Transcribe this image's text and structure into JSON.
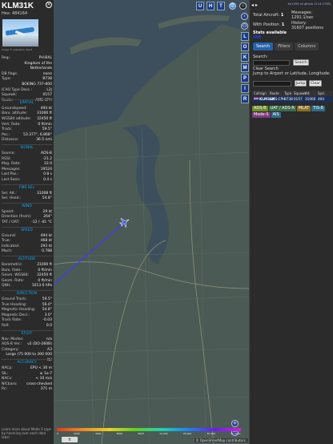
{
  "infoblock": {
    "callsign": "KLM31K",
    "hex": "Hex: 484164",
    "photo_credit": "Image © sebastian david",
    "pre_rows": [
      {
        "k": "Reg.:",
        "v": "PH-BXL"
      },
      {
        "k": "",
        "v": "Kingdom of the Netherlands"
      },
      {
        "k": "DB flags:",
        "v": "none"
      },
      {
        "k": "Type:",
        "v": "B738"
      },
      {
        "k": "",
        "v": "BOEING 737-800"
      },
      {
        "k": "ICAO Type Desc.:",
        "v": "L2J"
      },
      {
        "k": "Squawk:",
        "v": "0157"
      },
      {
        "k": "Route:",
        "v": "AMS-CPH"
      }
    ],
    "sections": [
      {
        "title": "SPATIAL",
        "rows": [
          {
            "k": "Groundspeed:",
            "v": "494 kt"
          },
          {
            "k": "Baro. altitude:",
            "v": "31000 ft"
          },
          {
            "k": "WGS84 altitude:",
            "v": "32450 ft"
          },
          {
            "k": "Vert. Rate:",
            "v": "0 ft/min"
          },
          {
            "k": "Track:",
            "v": "59.5°"
          },
          {
            "k": "Pos.:",
            "v": "53.377°, 6.868°"
          },
          {
            "k": "Distance:",
            "v": "36.5 nmi"
          }
        ]
      },
      {
        "title": "SIGNAL",
        "rows": [
          {
            "k": "Source:",
            "v": "ADS-B"
          },
          {
            "k": "RSSI:",
            "v": "-21.2"
          },
          {
            "k": "Msg. Rate:",
            "v": "22.0"
          },
          {
            "k": "Messages:",
            "v": "19524"
          },
          {
            "k": "Last Pos.:",
            "v": "0.8 s"
          },
          {
            "k": "Last Seen:",
            "v": "0.4 s"
          }
        ]
      },
      {
        "title": "FMS SEL",
        "rows": [
          {
            "k": "Sel. Alt.:",
            "v": "31008 ft"
          },
          {
            "k": "Sel. Head.:",
            "v": "54.8°"
          }
        ]
      },
      {
        "title": "WIND",
        "rows": [
          {
            "k": "Speed:",
            "v": "29 kt"
          },
          {
            "k": "Direction (from):",
            "v": "264°"
          },
          {
            "k": "TAT / OAT:",
            "v": "-12 / -41 °C"
          }
        ]
      },
      {
        "title": "SPEED",
        "rows": [
          {
            "k": "Ground:",
            "v": "494 kt"
          },
          {
            "k": "True:",
            "v": "468 kt"
          },
          {
            "k": "Indicated:",
            "v": "293 kt"
          },
          {
            "k": "Mach:",
            "v": "0.788"
          }
        ]
      },
      {
        "title": "ALTITUDE",
        "rows": [
          {
            "k": "Barometric:",
            "v": "31000 ft"
          },
          {
            "k": "Baro. Rate:",
            "v": "0 ft/min"
          },
          {
            "k": "Geom. WGS84:",
            "v": "32450 ft"
          },
          {
            "k": "Geom. Rate:",
            "v": "0 ft/min"
          },
          {
            "k": "QNH:",
            "v": "1013.6 hPa"
          }
        ]
      },
      {
        "title": "DIRECTION",
        "rows": [
          {
            "k": "Ground Track:",
            "v": "59.5°"
          },
          {
            "k": "True Heading:",
            "v": "56.0°"
          },
          {
            "k": "Magnetic Heading:",
            "v": "54.8°"
          },
          {
            "k": "Magnetic Decl.:",
            "v": "3.0°"
          },
          {
            "k": "Track Rate:",
            "v": "-0.03"
          },
          {
            "k": "Roll:",
            "v": "0.0"
          }
        ]
      },
      {
        "title": "STUFF",
        "rows": [
          {
            "k": "Nav. Modes:",
            "v": "n/a"
          },
          {
            "k": "ADS-B Ver.:",
            "v": "v2 (DO-260B)"
          },
          {
            "k": "Category:",
            "v": "A3"
          },
          {
            "k": "",
            "v": "Large (75 000 to 300 000 lb)"
          }
        ]
      },
      {
        "title": "ACCURACY",
        "rows": [
          {
            "k": "NACp:",
            "v": "EPU < 30 m"
          },
          {
            "k": "SIL:",
            "v": "≤ 1e-7"
          },
          {
            "k": "NACv:",
            "v": "< 10 m/s"
          },
          {
            "k": "NICbaro:",
            "v": "cross-checked"
          },
          {
            "k": "Rc:",
            "v": "371 m"
          }
        ]
      }
    ],
    "footnote": "Learn more about Mode S type by hovering over each data label"
  },
  "map": {
    "buttons_top": [
      "U",
      "H",
      "T"
    ],
    "side_buttons": [
      "L",
      "O",
      "K",
      "M",
      "P",
      "I",
      "R"
    ],
    "nav_left": "‹",
    "nav_right": "›",
    "zoom_in": "+",
    "zoom_out": "−",
    "legend_labels": [
      "0",
      "2000",
      "4000",
      "6000",
      "8000",
      "10 000",
      "20 000",
      "30 000",
      "40 000+"
    ],
    "feet_button": "ft",
    "attribution": "© OpenStreetMap contributors.",
    "plane_color": "#3b5bdb",
    "track_color": "#3b3bff"
  },
  "sidebar": {
    "toggle": "◂ ▸",
    "version_link": "tar1090 on github (3.14.1738)",
    "stats": {
      "total_label": "Total Aircraft:",
      "total_value": "1",
      "pos_label": "With Position:",
      "pos_value": "1",
      "msgs_label": "Messages:",
      "msgs_value": "1291.1/sec",
      "hist_label": "History:",
      "hist_value": "31607 positions"
    },
    "stats_title": "Stats available",
    "tabs": [
      "Search",
      "Filters",
      "Columns"
    ],
    "search_label": "Search:",
    "search_button": "Search",
    "clear_search": "Clear Search",
    "jump_label": "Jump to Airport or Latitude, Longitude:",
    "jump_button": "Jump",
    "clear_button": "Clear",
    "check_label": "",
    "columns": [
      "Callsign",
      "Route",
      "Type",
      "Squawk",
      "Alt. (ft)",
      "Spd. (kt)"
    ],
    "row": {
      "callsign": "KLM31K",
      "route": "AMS-CPH",
      "type": "B738",
      "squawk": "0157",
      "alt": "31000",
      "spd": "494"
    },
    "sources_line1": [
      "ADS-B",
      "UAT / ADS-R",
      "MLAT",
      "TIS-B"
    ],
    "sources_line2": [
      "Mode-S",
      "AIS"
    ]
  }
}
